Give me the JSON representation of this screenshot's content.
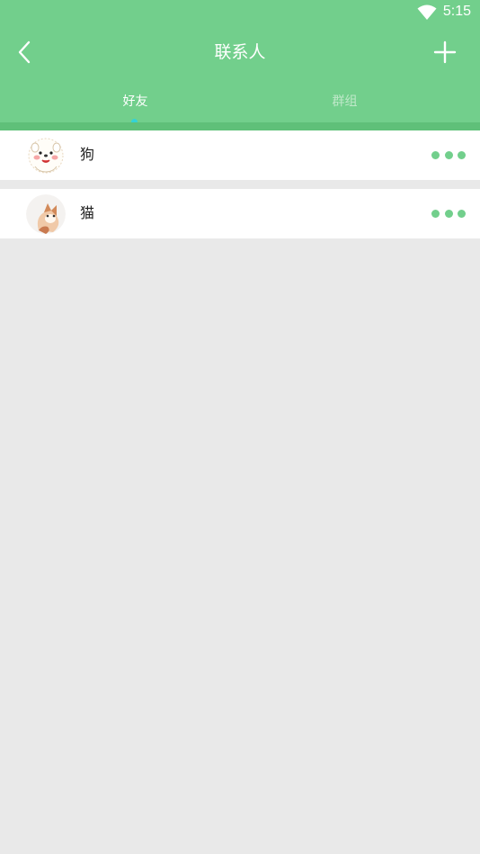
{
  "status_bar": {
    "time": "5:15",
    "wifi_icon": "wifi-icon"
  },
  "header": {
    "title": "联系人",
    "back_icon": "chevron-left-icon",
    "add_icon": "plus-icon",
    "background_color": "#72cf8c"
  },
  "tabs": [
    {
      "label": "好友",
      "active": true
    },
    {
      "label": "群组",
      "active": false
    }
  ],
  "contacts": [
    {
      "name": "狗",
      "avatar": "dog-avatar",
      "more_icon": "more-dots-icon"
    },
    {
      "name": "猫",
      "avatar": "cat-avatar",
      "more_icon": "more-dots-icon"
    }
  ],
  "colors": {
    "accent": "#72cf8c",
    "tab_indicator": "#34d3d6",
    "background": "#e9e9e9"
  }
}
